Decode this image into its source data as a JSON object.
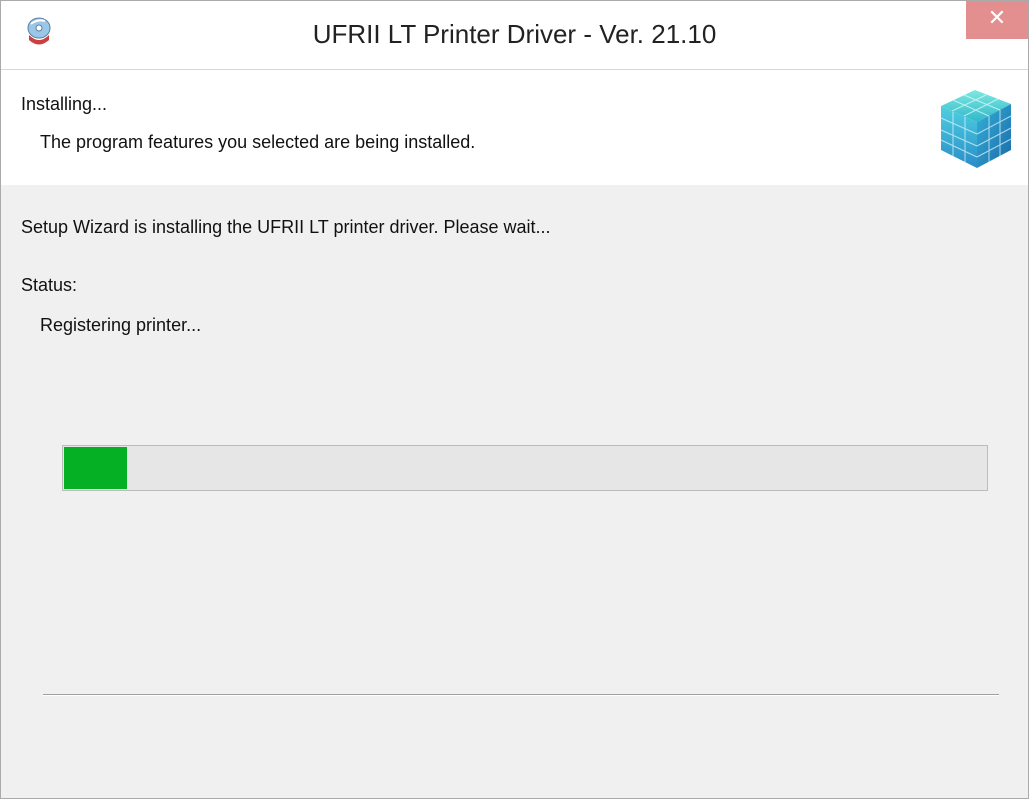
{
  "window": {
    "title": "UFRII LT Printer Driver - Ver. 21.10",
    "close_glyph": "✕",
    "icon": "installer-disc-icon"
  },
  "header": {
    "title": "Installing...",
    "subtitle": "The program features you selected are being installed.",
    "graphic": "cube-stack-icon"
  },
  "body": {
    "message": "Setup Wizard is installing the UFRII LT printer driver. Please wait...",
    "status_label": "Status:",
    "status_text": "Registering printer..."
  },
  "progress": {
    "fraction": 0.068,
    "color": "#06b025"
  },
  "colors": {
    "close_button": "#e38f8f",
    "panel_background": "#f0f0f0",
    "header_background": "#ffffff"
  }
}
